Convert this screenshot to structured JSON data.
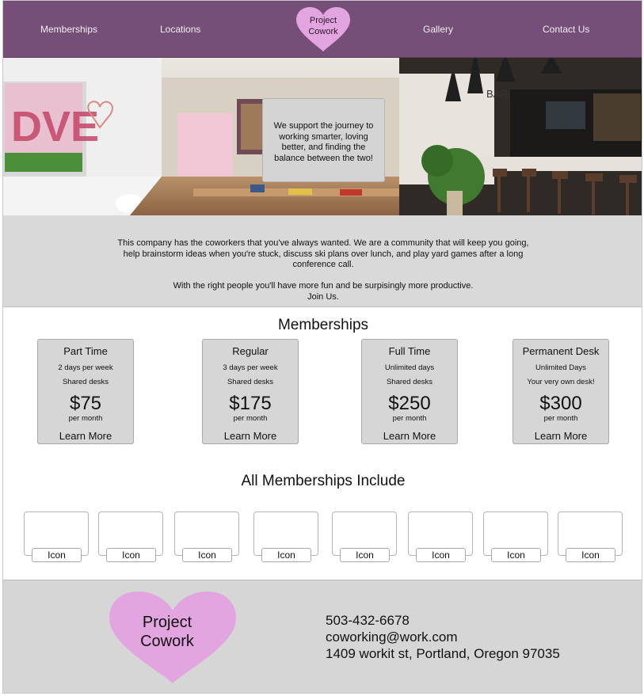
{
  "nav": {
    "items": [
      "Memberships",
      "Locations",
      "Gallery",
      "Contact Us"
    ],
    "logo_line1": "Project",
    "logo_line2": "Cowork"
  },
  "hero": {
    "tagline": "We support the journey to working smarter, loving better, and finding the balance between the two!"
  },
  "about": {
    "paragraph1": "This company has the coworkers that you've always wanted. We are a community that will keep you going, help brainstorm ideas when you're stuck, discuss ski plans over lunch, and play yard games after a long conference call.",
    "paragraph2_line1": "With the right people you'll have more fun and be surpisingly more productive.",
    "paragraph2_line2": "Join Us."
  },
  "memberships": {
    "title": "Memberships",
    "cards": [
      {
        "name": "Part Time",
        "detail1": "2 days per week",
        "detail2": "Shared desks",
        "price": "$75",
        "period": "per month",
        "cta": "Learn More"
      },
      {
        "name": "Regular",
        "detail1": "3 days per week",
        "detail2": "Shared desks",
        "price": "$175",
        "period": "per month",
        "cta": "Learn More"
      },
      {
        "name": "Full Time",
        "detail1": "Unlimited days",
        "detail2": "Shared desks",
        "price": "$250",
        "period": "per month",
        "cta": "Learn More"
      },
      {
        "name": "Permanent Desk",
        "detail1": "Unlimited Days",
        "detail2": "Your very own desk!",
        "price": "$300",
        "period": "per month",
        "cta": "Learn More"
      }
    ]
  },
  "includes": {
    "title": "All Memberships Include",
    "icons": [
      "Icon",
      "Icon",
      "Icon",
      "Icon",
      "Icon",
      "Icon",
      "Icon",
      "Icon"
    ]
  },
  "footer": {
    "logo_line1": "Project",
    "logo_line2": "Cowork",
    "phone": "503-432-6678",
    "email": "coworking@work.com",
    "address": "1409 workit st, Portland, Oregon 97035"
  },
  "colors": {
    "nav_bg": "#764f79",
    "heart": "#e3a5df",
    "panel_gray": "#d6d6d6"
  }
}
